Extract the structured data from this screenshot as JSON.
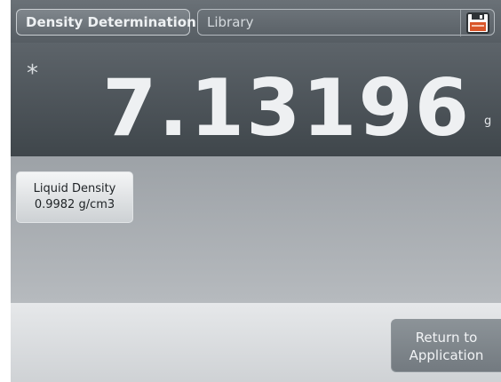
{
  "header": {
    "app_tab_label": "Density Determination",
    "library_tab_label": "Library",
    "save_icon": "floppy-disk-icon"
  },
  "display": {
    "stable_indicator": "*",
    "weight_value": "7.13196",
    "unit": "g"
  },
  "parameters": {
    "liquid_density": {
      "label": "Liquid Density",
      "value": "0.9982 g/cm3"
    }
  },
  "footer": {
    "return_line1": "Return to",
    "return_line2": "Application"
  },
  "colors": {
    "save_icon_accent": "#d9562a"
  }
}
